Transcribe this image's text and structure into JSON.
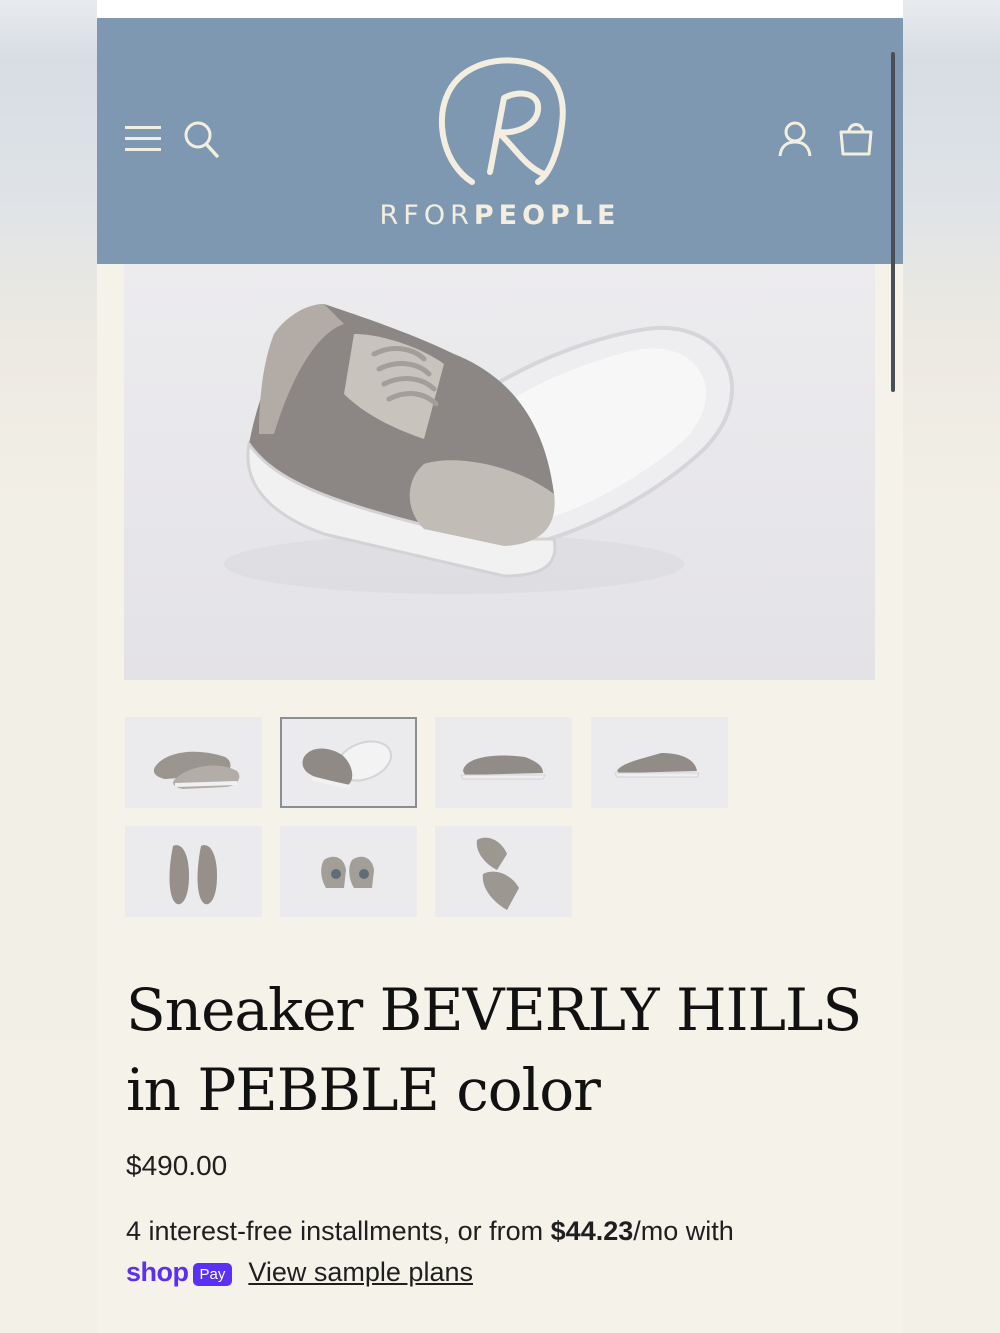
{
  "header": {
    "brand_part1": "RFOR",
    "brand_part2": "PEOPLE",
    "logo_letter": "R",
    "background_color": "#7d98b0",
    "icons": [
      "menu-icon",
      "search-icon",
      "account-icon",
      "bag-icon"
    ]
  },
  "gallery": {
    "main_image": "sneaker-pair-sole-view",
    "thumbnails": [
      {
        "image": "pair-side-view",
        "selected": false
      },
      {
        "image": "pair-sole-view",
        "selected": true
      },
      {
        "image": "side-profile",
        "selected": false
      },
      {
        "image": "side-profile-right",
        "selected": false
      },
      {
        "image": "front-view",
        "selected": false
      },
      {
        "image": "back-view",
        "selected": false
      },
      {
        "image": "top-angled-view",
        "selected": false
      }
    ]
  },
  "product": {
    "title": "Sneaker BEVERLY HILLS in PEBBLE color",
    "price": "$490.00",
    "installments_prefix": "4 interest-free installments, or from ",
    "installments_amount": "$44.23",
    "installments_suffix": "/mo with",
    "shop_word": "shop",
    "pay_badge": "Pay",
    "view_plans": "View sample plans",
    "shop_pay_color": "#5a31f4"
  }
}
